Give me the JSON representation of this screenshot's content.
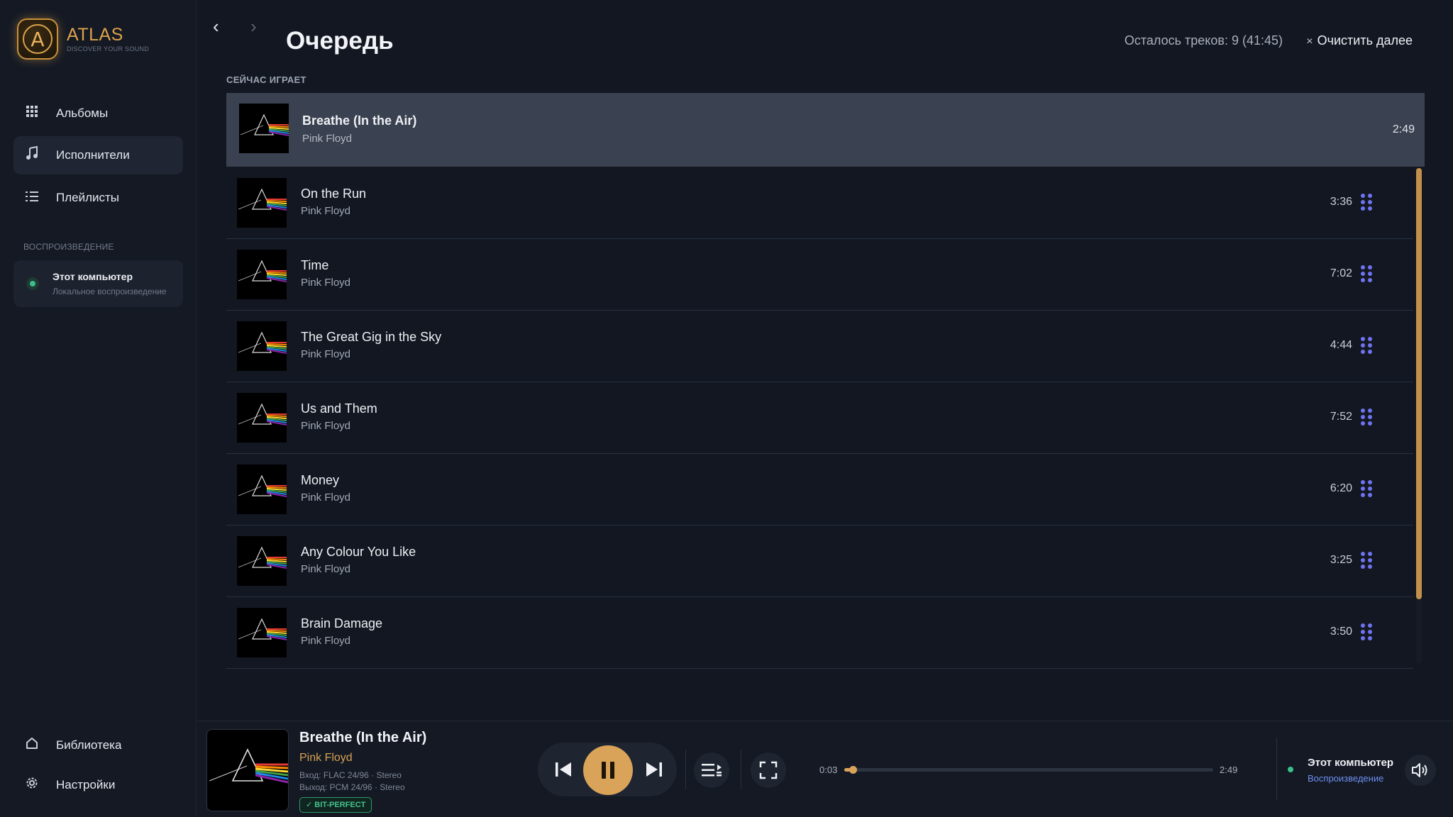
{
  "app": {
    "logo_title": "ATLAS",
    "logo_subtitle": "DISCOVER YOUR SOUND",
    "logo_letter": "A"
  },
  "sidebar": {
    "items": [
      {
        "label": "Альбомы",
        "icon": "grid-icon",
        "active": false
      },
      {
        "label": "Исполнители",
        "icon": "music-note-icon",
        "active": true
      },
      {
        "label": "Плейлисты",
        "icon": "list-icon",
        "active": false
      }
    ],
    "playback_section_label": "ВОСПРОИЗВЕДЕНИЕ",
    "device": {
      "name": "Этот компьютер",
      "subtitle": "Локальное воспроизведение"
    },
    "bottom_items": [
      {
        "label": "Библиотека",
        "icon": "home-icon"
      },
      {
        "label": "Настройки",
        "icon": "gear-icon"
      }
    ]
  },
  "header": {
    "back": "‹",
    "forward": "›",
    "title": "Очередь",
    "remaining": "Осталось треков: 9 (41:45)",
    "clear_label": "Очистить далее",
    "clear_icon": "×"
  },
  "now_playing_label": "СЕЙЧАС ИГРАЕТ",
  "now_playing": {
    "title": "Breathe (In the Air)",
    "artist": "Pink Floyd",
    "duration": "2:49"
  },
  "queue": [
    {
      "title": "On the Run",
      "artist": "Pink Floyd",
      "duration": "3:36"
    },
    {
      "title": "Time",
      "artist": "Pink Floyd",
      "duration": "7:02"
    },
    {
      "title": "The Great Gig in the Sky",
      "artist": "Pink Floyd",
      "duration": "4:44"
    },
    {
      "title": "Us and Them",
      "artist": "Pink Floyd",
      "duration": "7:52"
    },
    {
      "title": "Money",
      "artist": "Pink Floyd",
      "duration": "6:20"
    },
    {
      "title": "Any Colour You Like",
      "artist": "Pink Floyd",
      "duration": "3:25"
    },
    {
      "title": "Brain Damage",
      "artist": "Pink Floyd",
      "duration": "3:50"
    }
  ],
  "player": {
    "title": "Breathe (In the Air)",
    "artist": "Pink Floyd",
    "input": "Вход: FLAC 24/96 · Stereo",
    "output": "Выход: PCM 24/96 · Stereo",
    "badge": "✓ BIT-PERFECT",
    "current_time": "0:03",
    "total_time": "2:49",
    "progress": 0.018,
    "output_device": "Этот компьютер",
    "output_status": "Воспроизведение"
  },
  "colors": {
    "accent": "#d9a45a",
    "drag_handle": "#6f73f0",
    "status_green": "#3bc08a",
    "link_blue": "#6e8ff0"
  }
}
